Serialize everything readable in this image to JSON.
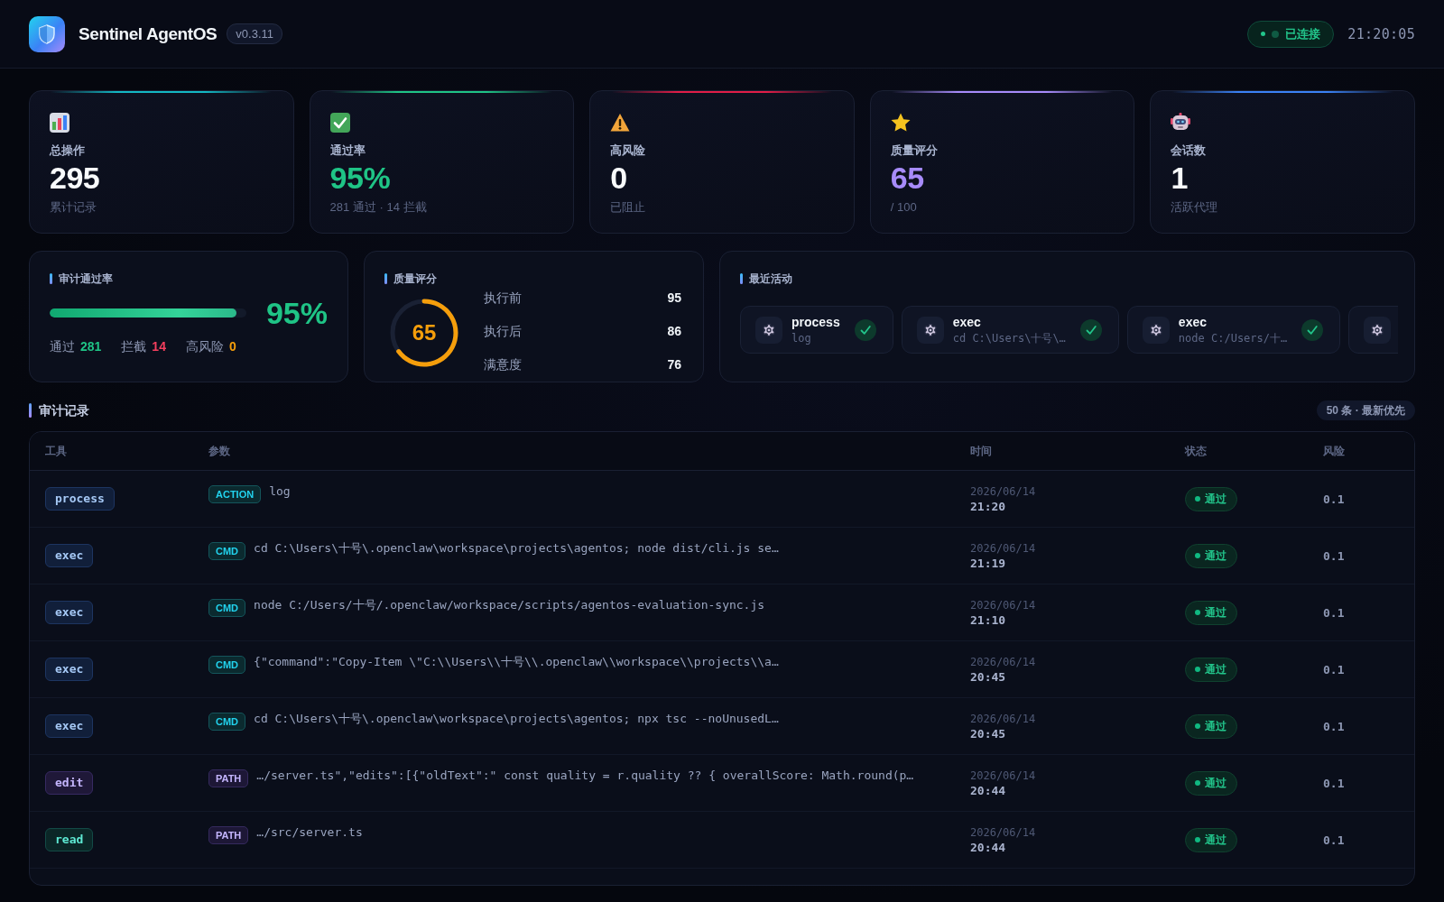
{
  "header": {
    "title": "Sentinel AgentOS",
    "version": "v0.3.11",
    "connection": {
      "label": "已连接",
      "connected": true
    },
    "clock": "21:20:05"
  },
  "stat_cards": [
    {
      "kind": "total",
      "label": "总操作",
      "value": "295",
      "note": "累计记录",
      "color": "#14b8c4",
      "highlight": false
    },
    {
      "kind": "pass_rate",
      "label": "通过率",
      "value": "95%",
      "note": "281 通过 · 14 拦截",
      "color": "#1fc486",
      "highlight": true
    },
    {
      "kind": "risk",
      "label": "高风险",
      "value": "0",
      "note": "已阻止",
      "color": "#e11d48",
      "highlight": false
    },
    {
      "kind": "quality",
      "label": "质量评分",
      "value": "65",
      "note": "/ 100",
      "color": "#a78bfa",
      "highlight": true
    },
    {
      "kind": "sessions",
      "label": "会话数",
      "value": "1",
      "note": "活跃代理",
      "color": "#3b82f6",
      "highlight": false
    }
  ],
  "pass_panel": {
    "title": "审计通过率",
    "level": 0.95,
    "percent": "95%",
    "stats": [
      {
        "label": "通过",
        "value": "281",
        "color": "#1fc486"
      },
      {
        "label": "拦截",
        "value": "14",
        "color": "#f43f5e"
      },
      {
        "label": "高风险",
        "value": "0",
        "color": "#f59e0b"
      }
    ]
  },
  "quality_panel": {
    "title": "质量评分",
    "score": "65",
    "metrics": [
      {
        "label": "执行前",
        "value": "95"
      },
      {
        "label": "执行后",
        "value": "86"
      },
      {
        "label": "满意度",
        "value": "76"
      }
    ]
  },
  "activity_panel": {
    "title": "最近活动",
    "items": [
      {
        "kind": "full",
        "name": "process",
        "detail": "log",
        "passed": true
      },
      {
        "kind": "full",
        "name": "exec",
        "detail": "cd C:\\Users\\十号\\…",
        "passed": true
      },
      {
        "kind": "full",
        "name": "exec",
        "detail": "node C:/Users/十…",
        "passed": true
      },
      {
        "kind": "clipped"
      }
    ]
  },
  "audit": {
    "title": "审计记录",
    "badge": "50 条 · 最新优先",
    "columns": [
      "工具",
      "参数",
      "时间",
      "状态",
      "风险"
    ],
    "rows": [
      {
        "tool": {
          "label": "process",
          "kind": "run"
        },
        "param_tag": {
          "label": "ACTION",
          "kind": "command"
        },
        "params": "log",
        "date": "2026/06/14",
        "time": "21:20",
        "status": {
          "label": "通过",
          "passed": true
        },
        "risk": "0.1"
      },
      {
        "tool": {
          "label": "exec",
          "kind": "run"
        },
        "param_tag": {
          "label": "CMD",
          "kind": "command"
        },
        "params": "cd C:\\Users\\十号\\.openclaw\\workspace\\projects\\agentos; node dist/cli.js se…",
        "date": "2026/06/14",
        "time": "21:19",
        "status": {
          "label": "通过",
          "passed": true
        },
        "risk": "0.1"
      },
      {
        "tool": {
          "label": "exec",
          "kind": "run"
        },
        "param_tag": {
          "label": "CMD",
          "kind": "command"
        },
        "params": "node C:/Users/十号/.openclaw/workspace/scripts/agentos-evaluation-sync.js",
        "date": "2026/06/14",
        "time": "21:10",
        "status": {
          "label": "通过",
          "passed": true
        },
        "risk": "0.1"
      },
      {
        "tool": {
          "label": "exec",
          "kind": "run"
        },
        "param_tag": {
          "label": "CMD",
          "kind": "command"
        },
        "params": "{\"command\":\"Copy-Item \\\"C:\\\\Users\\\\十号\\\\.openclaw\\\\workspace\\\\projects\\\\a…",
        "date": "2026/06/14",
        "time": "20:45",
        "status": {
          "label": "通过",
          "passed": true
        },
        "risk": "0.1"
      },
      {
        "tool": {
          "label": "exec",
          "kind": "run"
        },
        "param_tag": {
          "label": "CMD",
          "kind": "command"
        },
        "params": "cd C:\\Users\\十号\\.openclaw\\workspace\\projects\\agentos; npx tsc --noUnusedL…",
        "date": "2026/06/14",
        "time": "20:45",
        "status": {
          "label": "通过",
          "passed": true
        },
        "risk": "0.1"
      },
      {
        "tool": {
          "label": "edit",
          "kind": "edit"
        },
        "param_tag": {
          "label": "PATH",
          "kind": "path"
        },
        "params": "…/server.ts\",\"edits\":[{\"oldText\":\" const quality = r.quality ?? { overallScore: Math.round(p…",
        "date": "2026/06/14",
        "time": "20:44",
        "status": {
          "label": "通过",
          "passed": true
        },
        "risk": "0.1"
      },
      {
        "tool": {
          "label": "read",
          "kind": "read"
        },
        "param_tag": {
          "label": "PATH",
          "kind": "path"
        },
        "params": "…/src/server.ts",
        "date": "2026/06/14",
        "time": "20:44",
        "status": {
          "label": "通过",
          "passed": true
        },
        "risk": "0.1"
      }
    ]
  }
}
